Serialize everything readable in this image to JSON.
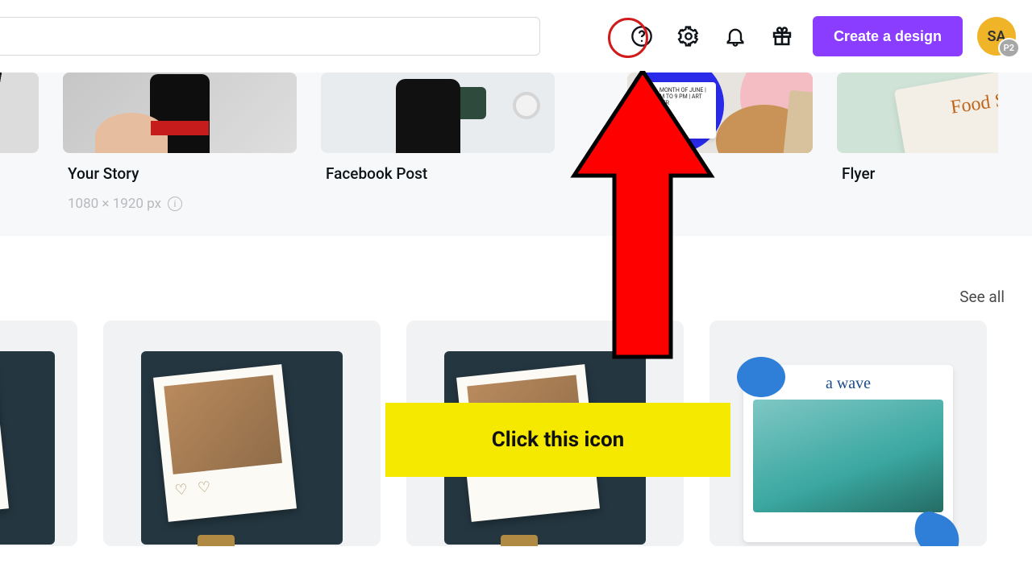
{
  "header": {
    "search_value": "",
    "create_label": "Create a design",
    "avatar_initials": "SA",
    "avatar_badge": "P2"
  },
  "templates": [
    {
      "label": "Your Story",
      "dimensions": "1080 × 1920 px"
    },
    {
      "label": "Facebook Post"
    },
    {
      "label": ""
    },
    {
      "label": "Flyer"
    }
  ],
  "poster_card_text": "ALL MONTH OF JUNE | 10 AM TO 9 PM | ART CENTER",
  "flyer_script": "Food S",
  "see_all_label": "See all",
  "trip_card": {
    "title": "a wave"
  },
  "annotation": {
    "label": "Click this icon"
  },
  "icons": {
    "help": "help-icon",
    "settings": "gear-icon",
    "notifications": "bell-icon",
    "gift": "gift-icon",
    "info": "info-icon"
  }
}
